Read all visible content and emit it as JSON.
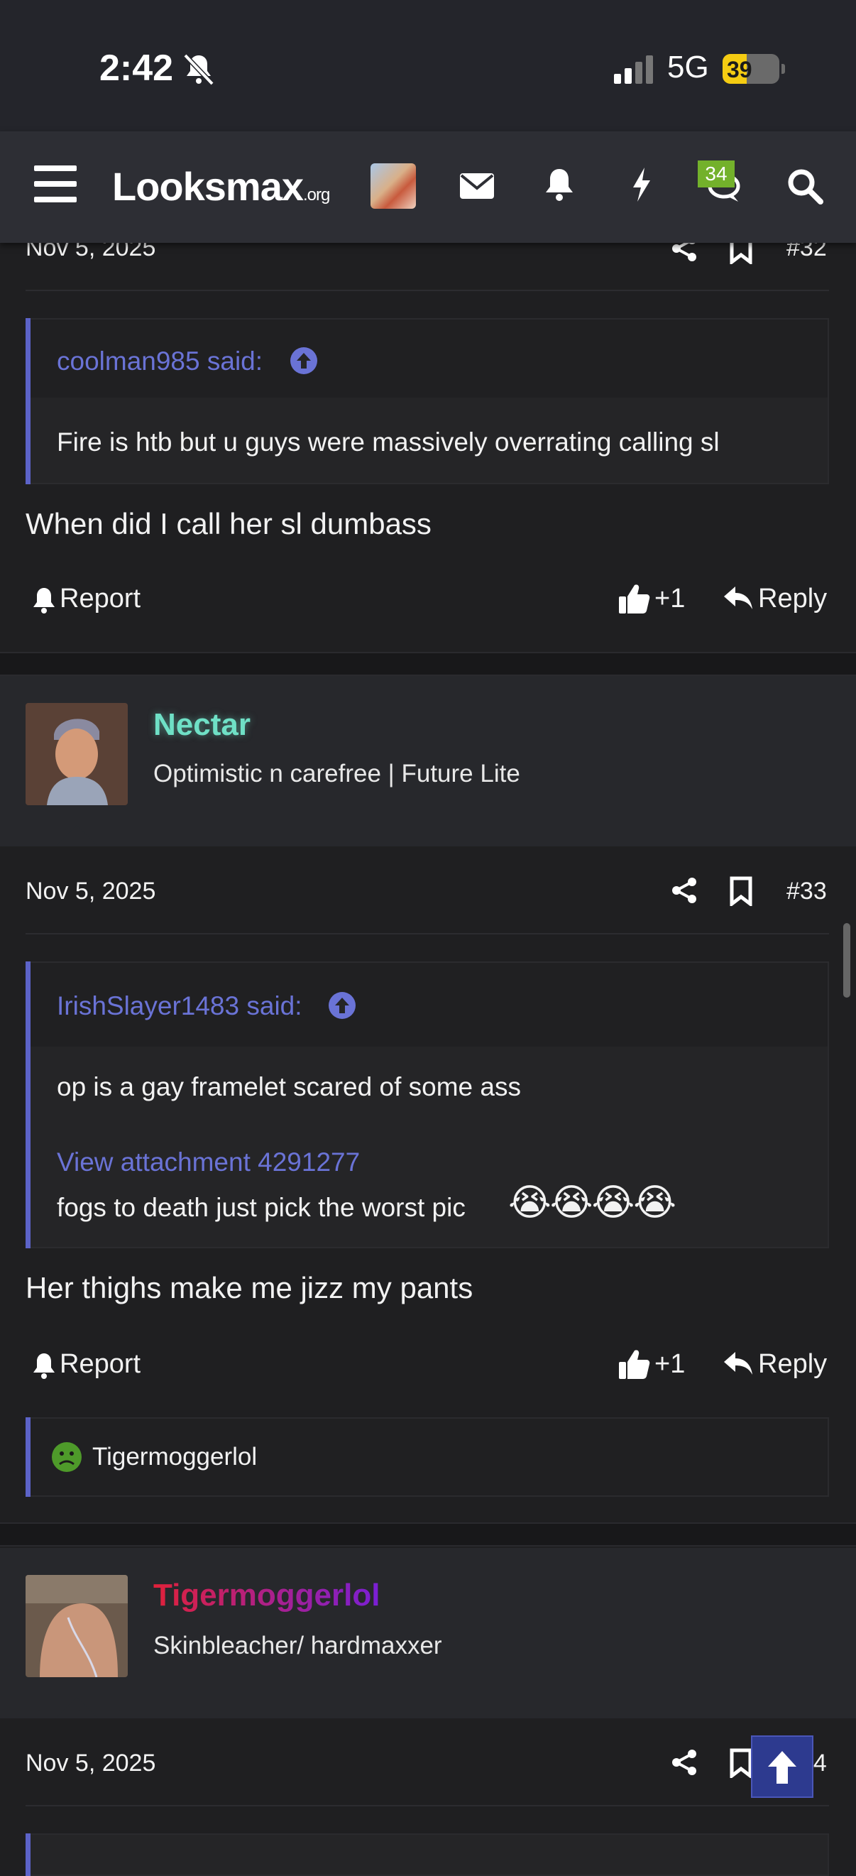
{
  "status_bar": {
    "time": "2:42",
    "network": "5G",
    "battery": "39"
  },
  "nav": {
    "logo_main": "Looksmax",
    "logo_suffix": ".org",
    "chat_badge": "34"
  },
  "post32": {
    "date": "Nov 5, 2025",
    "number": "#32",
    "quote_author": "coolman985 said:",
    "quote_text": "Fire is htb but u guys were massively overrating calling sl",
    "body": "When did I call her sl dumbass",
    "report": "Report",
    "reactions": "+1",
    "reply": "Reply"
  },
  "post33": {
    "username": "Nectar",
    "user_title": "Optimistic n carefree | Future Lite",
    "username_color": "#6fe0c6",
    "date": "Nov 5, 2025",
    "number": "#33",
    "quote_author": "IrishSlayer1483 said:",
    "quote_line1": "op is a gay framelet scared of some ass",
    "quote_link": "View attachment 4291277",
    "quote_line2": "fogs to death just pick the worst pic",
    "quote_emojis": "😭😭😭😭",
    "body": "Her thighs make me jizz my pants",
    "report": "Report",
    "reactions": "+1",
    "reply": "Reply",
    "reaction_user": "Tigermoggerlol"
  },
  "post34": {
    "username": "Tigermoggerlol",
    "user_title": "Skinbleacher/ hardmaxxer",
    "date": "Nov 5, 2025",
    "number": "#34"
  },
  "colors": {
    "accent": "#5c63c8",
    "link": "#6a73d6",
    "badge": "#73b12b"
  }
}
